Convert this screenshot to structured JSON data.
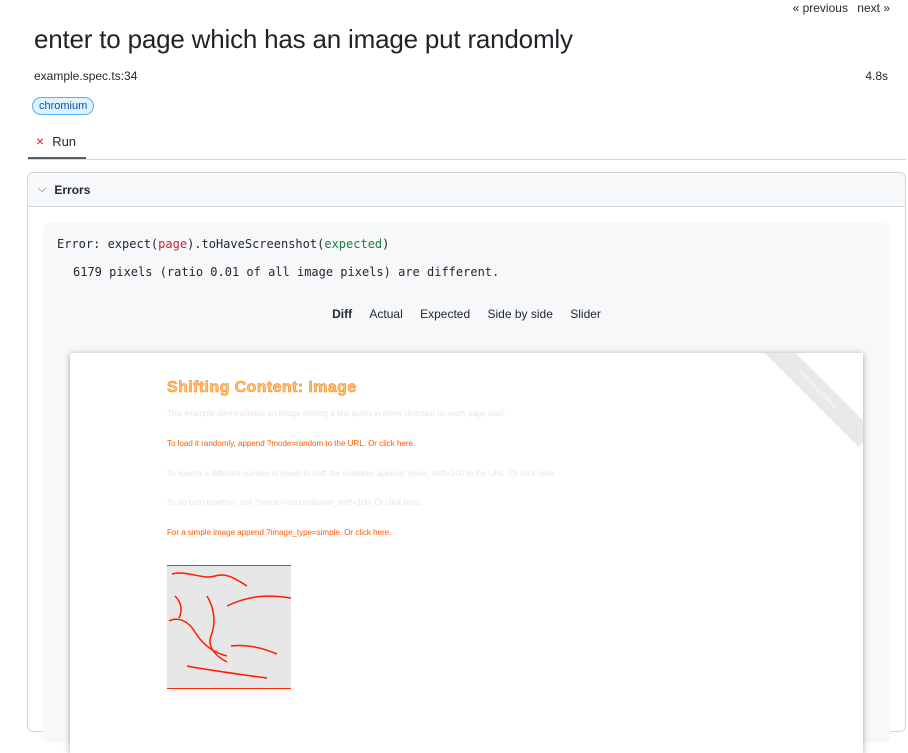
{
  "nav": {
    "previous": "« previous",
    "next": "next »"
  },
  "test": {
    "title": "enter to page which has an image put randomly",
    "spec": "example.spec.ts:34",
    "duration": "4.8s",
    "project_badge": "chromium"
  },
  "tabs": {
    "run": {
      "icon": "×",
      "label": "Run"
    }
  },
  "errors": {
    "header": "Errors",
    "chevron": "⌵",
    "line": {
      "prefix": "Error: expect(",
      "arg": "page",
      "middle": ").toHaveScreenshot(",
      "expected": "expected",
      "suffix": ")"
    },
    "pixels": "6179 pixels (ratio 0.01 of all image pixels) are different.",
    "view_tabs": [
      "Diff",
      "Actual",
      "Expected",
      "Side by side",
      "Slider"
    ],
    "selected_view": "Diff"
  },
  "screenshot": {
    "ribbon": "Fork me on GitHub",
    "title": "Shifting Content: Image",
    "paragraphs": [
      "This example demonstrates an image shifting a few pixels in either direction on each page load.",
      "To load it randomly, append ?mode=random to the URL. Or click here.",
      "To specify a different number of pixels to shift the example, append ?pixel_shift=100 to the URL. Or click here.",
      "To do both together, use ?mode=random&pixel_shift=100. Or click here.",
      "For a simple image append ?image_type=simple. Or click here."
    ]
  }
}
